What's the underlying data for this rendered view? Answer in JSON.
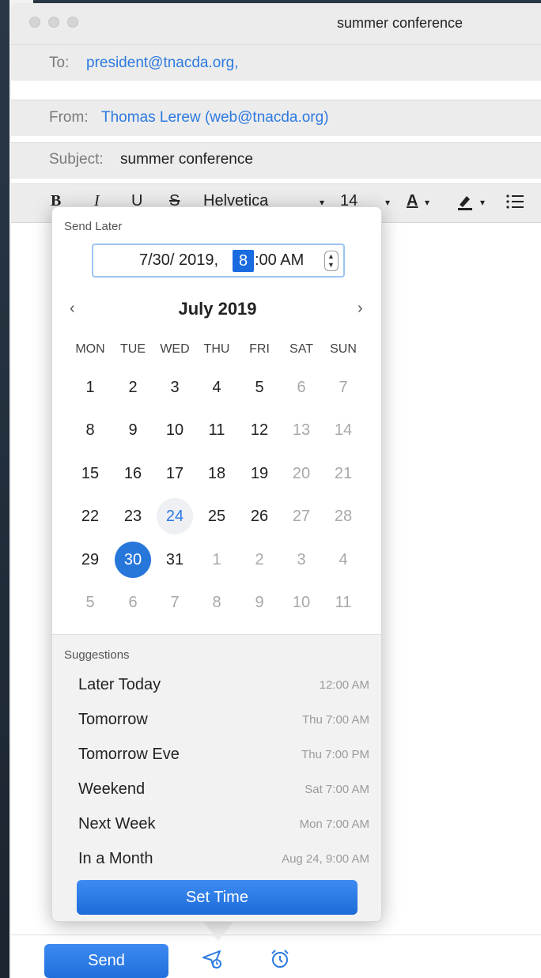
{
  "window": {
    "title": "summer conference"
  },
  "header": {
    "to_label": "To:",
    "to_value": "president@tnacda.org,",
    "from_label": "From:",
    "from_value": "Thomas Lerew (web@tnacda.org)",
    "subject_label": "Subject:",
    "subject_value": "summer conference"
  },
  "toolbar": {
    "bold": "B",
    "italic": "I",
    "underline": "U",
    "strikethrough": "S",
    "font": "Helvetica",
    "font_size": "14",
    "text_color": "A"
  },
  "send_later": {
    "label": "Send Later",
    "date_text": "7/30/ 2019,",
    "hour": "8",
    "time_rest": ":00 AM",
    "month_title": "July 2019",
    "prev": "‹",
    "next": "›",
    "weekdays": [
      "MON",
      "TUE",
      "WED",
      "THU",
      "FRI",
      "SAT",
      "SUN"
    ],
    "weeks": [
      [
        "1",
        "2",
        "3",
        "4",
        "5",
        "6",
        "7"
      ],
      [
        "8",
        "9",
        "10",
        "11",
        "12",
        "13",
        "14"
      ],
      [
        "15",
        "16",
        "17",
        "18",
        "19",
        "20",
        "21"
      ],
      [
        "22",
        "23",
        "24",
        "25",
        "26",
        "27",
        "28"
      ],
      [
        "29",
        "30",
        "31",
        "1",
        "2",
        "3",
        "4"
      ],
      [
        "5",
        "6",
        "7",
        "8",
        "9",
        "10",
        "11"
      ]
    ],
    "today": "24",
    "selected": "30"
  },
  "suggestions": {
    "label": "Suggestions",
    "items": [
      {
        "label": "Later Today",
        "time": "12:00 AM"
      },
      {
        "label": "Tomorrow",
        "time": "Thu 7:00 AM"
      },
      {
        "label": "Tomorrow Eve",
        "time": "Thu 7:00 PM"
      },
      {
        "label": "Weekend",
        "time": "Sat 7:00 AM"
      },
      {
        "label": "Next Week",
        "time": "Mon 7:00 AM"
      },
      {
        "label": "In a Month",
        "time": "Aug 24, 9:00 AM"
      }
    ],
    "set_time": "Set Time"
  },
  "bottom": {
    "send": "Send"
  },
  "colors": {
    "accent": "#2777db",
    "link": "#2d7ae0"
  }
}
